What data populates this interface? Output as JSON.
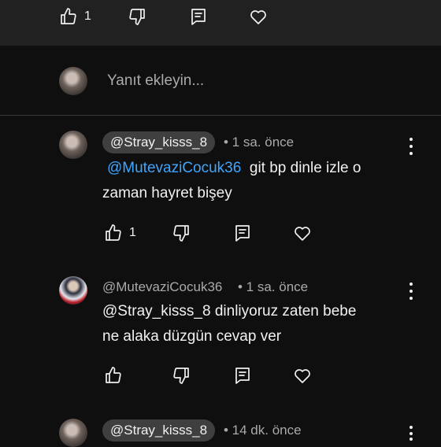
{
  "top_actions": {
    "like_count": "1"
  },
  "reply_box": {
    "placeholder": "Yanıt ekleyin..."
  },
  "comments": [
    {
      "author": "@Stray_kisss_8",
      "time": "• 1 sa. önce",
      "mention": "@MutevaziCocuk36",
      "text_line1": "git bp dinle izle o",
      "text_line2": "zaman hayret bişey",
      "like_count": "1"
    },
    {
      "author": "@MutevaziCocuk36",
      "time": "• 1 sa. önce",
      "text_line1": "@Stray_kisss_8  dinliyoruz zaten bebe",
      "text_line2": "ne alaka düzgün cevap ver",
      "like_count": ""
    },
    {
      "author": "@Stray_kisss_8",
      "time": "• 14 dk. önce"
    }
  ],
  "icons": [
    "like-icon",
    "dislike-icon",
    "reply-icon",
    "heart-icon",
    "more-vert-icon"
  ],
  "colors": {
    "background": "#0f0f0f",
    "top_bar": "#212121",
    "mention": "#3ea6ff",
    "chip": "#3f3f3f",
    "muted": "#aaaaaa"
  }
}
